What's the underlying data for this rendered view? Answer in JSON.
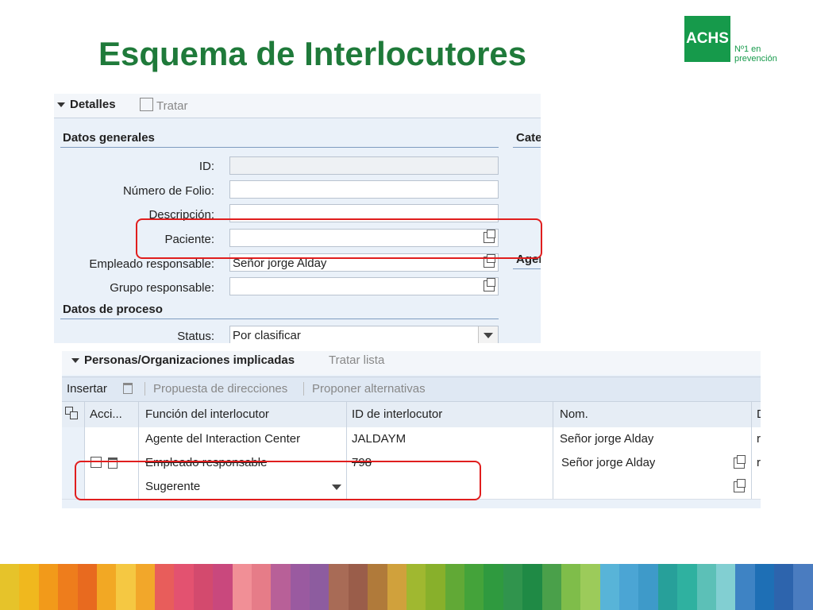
{
  "slide": {
    "title": "Esquema de Interlocutores",
    "logo": {
      "brand": "ACHS",
      "tagline_1": "Nº1 en",
      "tagline_2": "prevención",
      "color": "#169a4b"
    }
  },
  "details_panel": {
    "header": {
      "title": "Detalles",
      "action_label": "Tratar"
    },
    "sections": {
      "general": "Datos generales",
      "category_partial": "Cate",
      "agents_partial": "Agen",
      "process": "Datos de proceso"
    },
    "fields": {
      "id": {
        "label": "ID:",
        "value": ""
      },
      "folio": {
        "label": "Número de Folio:",
        "value": ""
      },
      "description": {
        "label": "Descripción:",
        "value": ""
      },
      "patient": {
        "label": "Paciente:",
        "value": ""
      },
      "employee": {
        "label": "Empleado responsable:",
        "value": "Señor jorge Alday"
      },
      "group": {
        "label": "Grupo responsable:",
        "value": ""
      },
      "status": {
        "label": "Status:",
        "value": "Por clasificar"
      }
    }
  },
  "partners_panel": {
    "header": {
      "title": "Personas/Organizaciones implicadas",
      "action_label": "Tratar lista"
    },
    "toolbar": {
      "insert": "Insertar",
      "address_proposal": "Propuesta de direcciones",
      "propose_alternatives": "Proponer alternativas"
    },
    "columns": [
      "Acci...",
      "Función del interlocutor",
      "ID de interlocutor",
      "Nom.",
      "D"
    ],
    "rows": [
      {
        "function": "Agente del Interaction Center",
        "partner_id": "JALDAYM",
        "name": "Señor jorge Alday",
        "extra": "r"
      },
      {
        "function": "Empleado responsable",
        "partner_id": "798",
        "name": "Señor jorge Alday",
        "extra": "r"
      },
      {
        "function": "Sugerente",
        "partner_id": "",
        "name": "",
        "extra": ""
      }
    ]
  },
  "colors": {
    "title": "#1f7a3a",
    "highlight": "#e01e1e",
    "panel_bg": "#eaf1f9"
  },
  "stripe_colors": [
    "#e6c32a",
    "#f0b81e",
    "#f29a1a",
    "#ee7d1c",
    "#e86a1f",
    "#f2a824",
    "#f5c842",
    "#f2a72a",
    "#e85d5b",
    "#e35270",
    "#d34a6e",
    "#c9487d",
    "#f18f96",
    "#e67c88",
    "#b86098",
    "#9a5aa0",
    "#8d5c9f",
    "#a86b56",
    "#9a5d4a",
    "#b07a3a",
    "#d0a13c",
    "#a0b830",
    "#88b02b",
    "#61a936",
    "#44a33a",
    "#2f9a3f",
    "#30944d",
    "#1f8a45",
    "#4aa04a",
    "#7fbd4a",
    "#9ccb5a",
    "#58b4d8",
    "#4ba5d4",
    "#3e9ac9",
    "#27a09a",
    "#2fb1a0",
    "#5cc0b7",
    "#82cfd2",
    "#3e83c4",
    "#1e6fb5",
    "#2d64ad",
    "#4a7cc0"
  ]
}
